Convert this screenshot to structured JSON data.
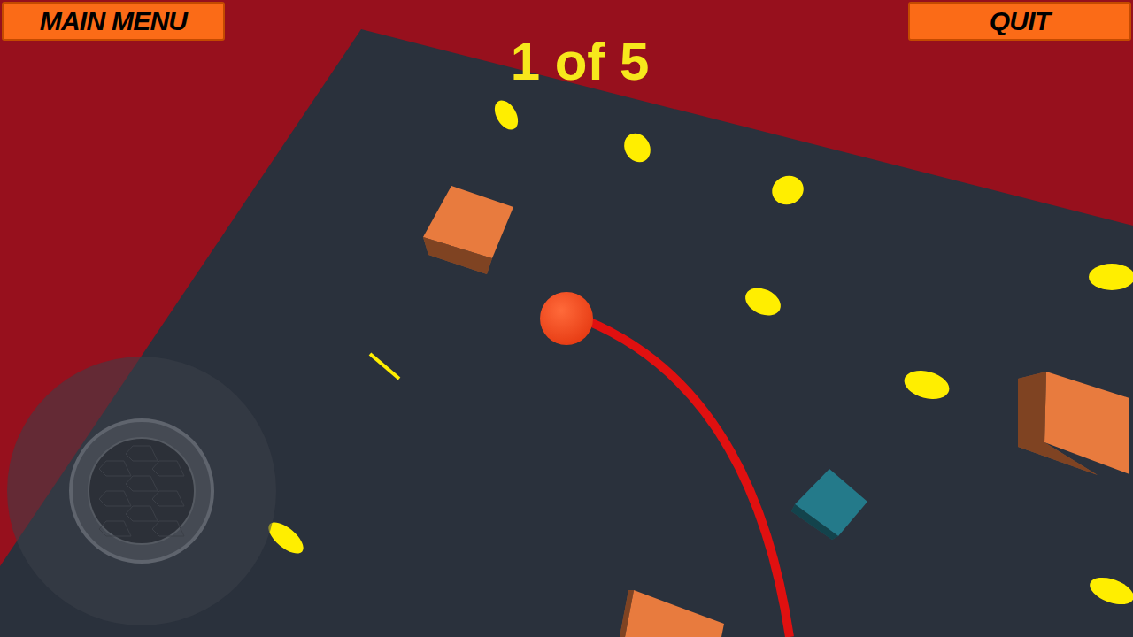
{
  "buttons": [
    {
      "label": "MAIN MENU"
    },
    {
      "label": "QUIT"
    }
  ],
  "counter": "1 of 5",
  "boxes": [
    {
      "color": "#e87b3e"
    },
    {
      "color": "#e87b3e"
    },
    {
      "color": "#247a8a"
    },
    {
      "color": "#e87b3e"
    }
  ]
}
